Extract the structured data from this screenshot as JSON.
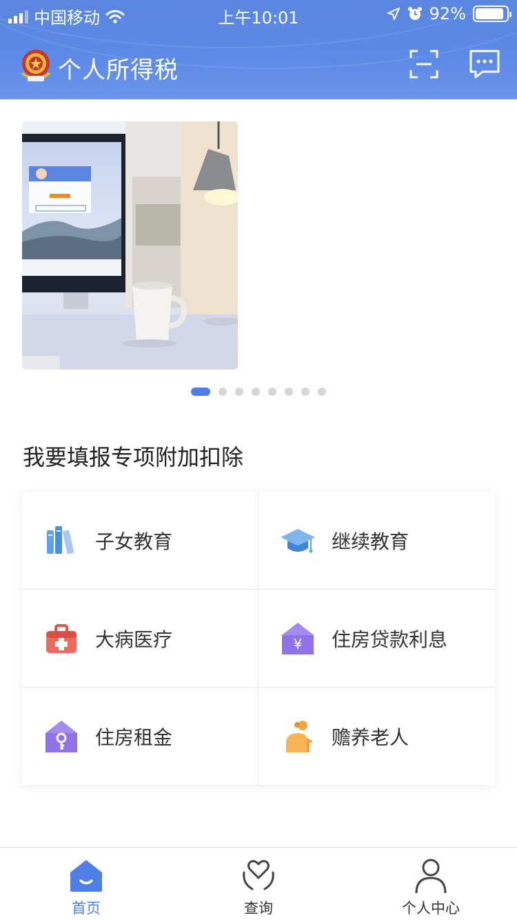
{
  "status_bar": {
    "carrier": "中国移动",
    "time": "上午10:01",
    "battery": "92%",
    "battery_level": 0.92,
    "icons": [
      "signal-icon",
      "wifi-icon",
      "location-icon",
      "alarm-icon",
      "battery-icon"
    ]
  },
  "header": {
    "title": "个人所得税",
    "icons": [
      "emblem-icon",
      "scan-icon",
      "message-icon"
    ],
    "color": "#5d8ae6"
  },
  "banner": {
    "page_count": 8,
    "active_index": 0
  },
  "section": {
    "title": "我要填报专项附加扣除",
    "items": [
      {
        "label": "子女教育",
        "icon": "books-icon"
      },
      {
        "label": "继续教育",
        "icon": "graduation-cap-icon"
      },
      {
        "label": "大病医疗",
        "icon": "medical-kit-icon"
      },
      {
        "label": "住房贷款利息",
        "icon": "house-yuan-icon"
      },
      {
        "label": "住房租金",
        "icon": "house-key-icon"
      },
      {
        "label": "赡养老人",
        "icon": "elderly-person-icon"
      }
    ]
  },
  "tabbar": {
    "tabs": [
      {
        "label": "首页",
        "icon": "home-icon",
        "active": true
      },
      {
        "label": "查询",
        "icon": "heart-hands-icon",
        "active": false
      },
      {
        "label": "个人中心",
        "icon": "person-icon",
        "active": false
      }
    ]
  },
  "accent_color": "#4f7fe6"
}
